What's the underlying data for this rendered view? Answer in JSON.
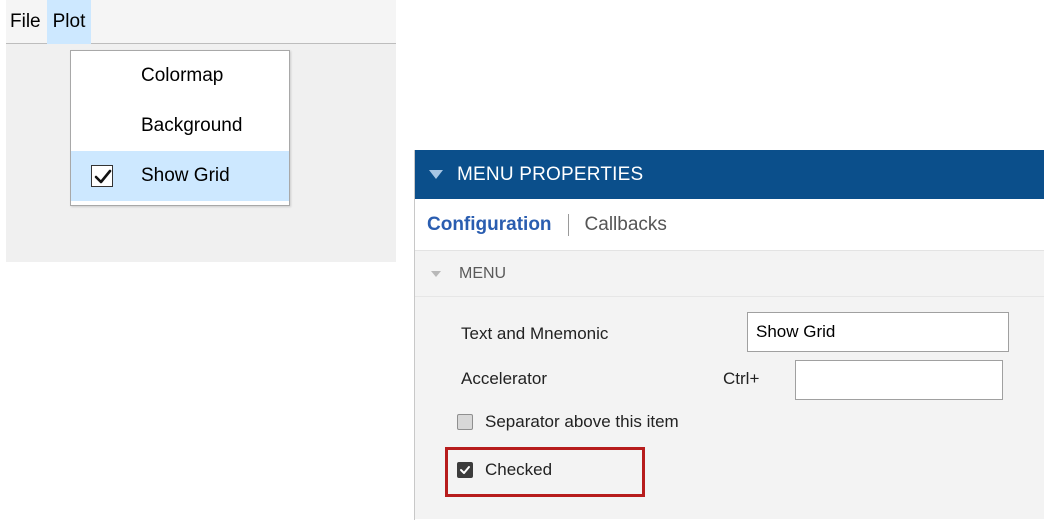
{
  "menubar": {
    "items": [
      {
        "label": "File"
      },
      {
        "label": "Plot"
      }
    ]
  },
  "plot_menu": {
    "items": [
      {
        "label": "Colormap",
        "checked": false
      },
      {
        "label": "Background",
        "checked": false
      },
      {
        "label": "Show Grid",
        "checked": true
      }
    ]
  },
  "panel": {
    "title": "MENU PROPERTIES",
    "tabs": [
      {
        "label": "Configuration",
        "active": true
      },
      {
        "label": "Callbacks",
        "active": false
      }
    ],
    "section": "MENU",
    "fields": {
      "text_label": "Text and Mnemonic",
      "text_value": "Show Grid",
      "accelerator_label": "Accelerator",
      "accelerator_prefix": "Ctrl+",
      "accelerator_value": ""
    },
    "checkboxes": {
      "separator_label": "Separator above this item",
      "separator_checked": false,
      "checked_label": "Checked",
      "checked_checked": true
    }
  },
  "colors": {
    "panel_header": "#0b4f8b",
    "menu_highlight": "#cde8ff",
    "active_tab": "#2a5db0",
    "annotation_box": "#b71c1c"
  }
}
